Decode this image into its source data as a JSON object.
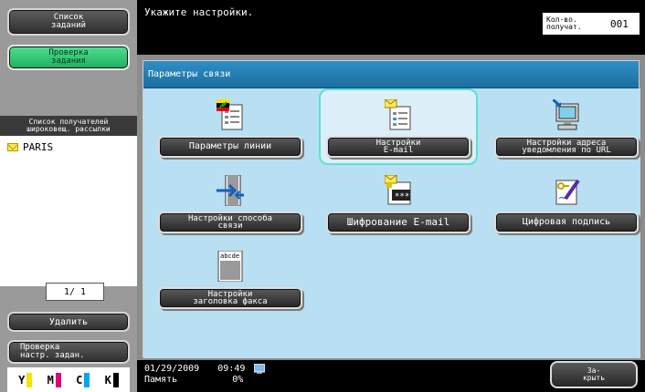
{
  "sidebar": {
    "job_list": [
      "Список",
      "заданий"
    ],
    "check_job": [
      "Проверка",
      "задания"
    ],
    "broadcast_header": [
      "Список получателей",
      "широковещ. рассылки"
    ],
    "recipients": [
      {
        "name": "PARIS"
      }
    ],
    "page_indicator": "1/  1",
    "delete_label": "Удалить",
    "check_settings": [
      "Проверка",
      "настр. задан."
    ]
  },
  "ink": {
    "items": [
      {
        "label": "Y",
        "color": "#f2e600"
      },
      {
        "label": "M",
        "color": "#e0007a"
      },
      {
        "label": "C",
        "color": "#00a8e8"
      },
      {
        "label": "K",
        "color": "#000000"
      }
    ]
  },
  "header": {
    "instruction": "Укажите настройки.",
    "copies_label": [
      "Кол-во.",
      "получат."
    ],
    "copies_value": "001"
  },
  "main": {
    "tab_title": "Параметры связи",
    "options": [
      {
        "lines": [
          "Параметры линии"
        ],
        "icon": "line-params-icon"
      },
      {
        "lines": [
          "Настройки",
          "E-mail"
        ],
        "icon": "email-settings-icon"
      },
      {
        "lines": [
          "Настройки адреса",
          "уведомления по URL"
        ],
        "icon": "url-notification-icon"
      },
      {
        "lines": [
          "Настройки способа",
          "связи"
        ],
        "icon": "comm-method-icon"
      },
      {
        "lines": [
          "Шифрование E-mail"
        ],
        "icon": "email-encryption-icon"
      },
      {
        "lines": [
          "Цифровая подпись"
        ],
        "icon": "digital-signature-icon"
      },
      {
        "lines": [
          "Настройки",
          "заголовка факса"
        ],
        "icon": "fax-header-icon"
      }
    ],
    "selected_index": 1
  },
  "footer": {
    "date": "01/29/2009",
    "time": "09:49",
    "memory_label": "Память",
    "memory_value": "0%",
    "close": [
      "За-",
      "крыть"
    ]
  }
}
